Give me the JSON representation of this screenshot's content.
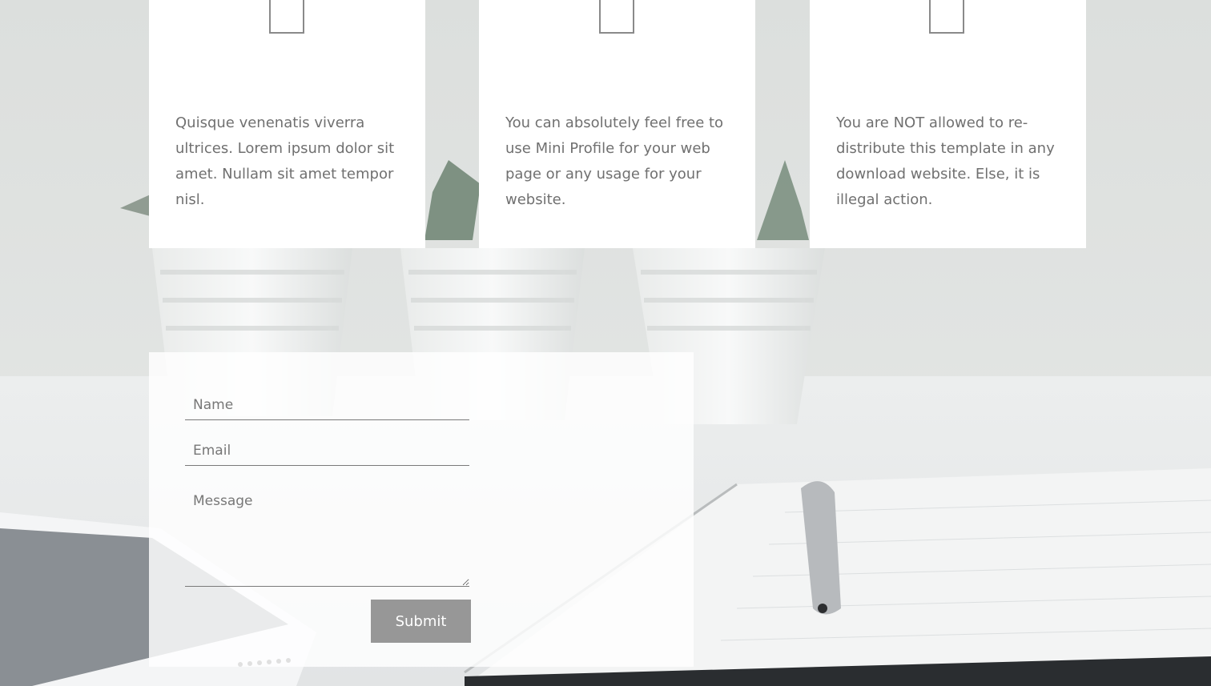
{
  "features": [
    {
      "icon": "empty-icon-placeholder",
      "text": "Quisque venenatis viverra ultrices. Lorem ipsum dolor sit amet. Nullam sit amet tempor nisl."
    },
    {
      "icon": "empty-icon-placeholder",
      "text": "You can absolutely feel free to use Mini Profile for your web page or any usage for your website."
    },
    {
      "icon": "empty-icon-placeholder",
      "text": "You are NOT allowed to re-distribute this template in any download website. Else, it is illegal action."
    }
  ],
  "contact_form": {
    "name_placeholder": "Name",
    "email_placeholder": "Email",
    "message_placeholder": "Message",
    "submit_label": "Submit"
  },
  "colors": {
    "card_background": "#ffffff",
    "body_text": "#707070",
    "button_background": "#979797",
    "button_text": "#ffffff"
  }
}
